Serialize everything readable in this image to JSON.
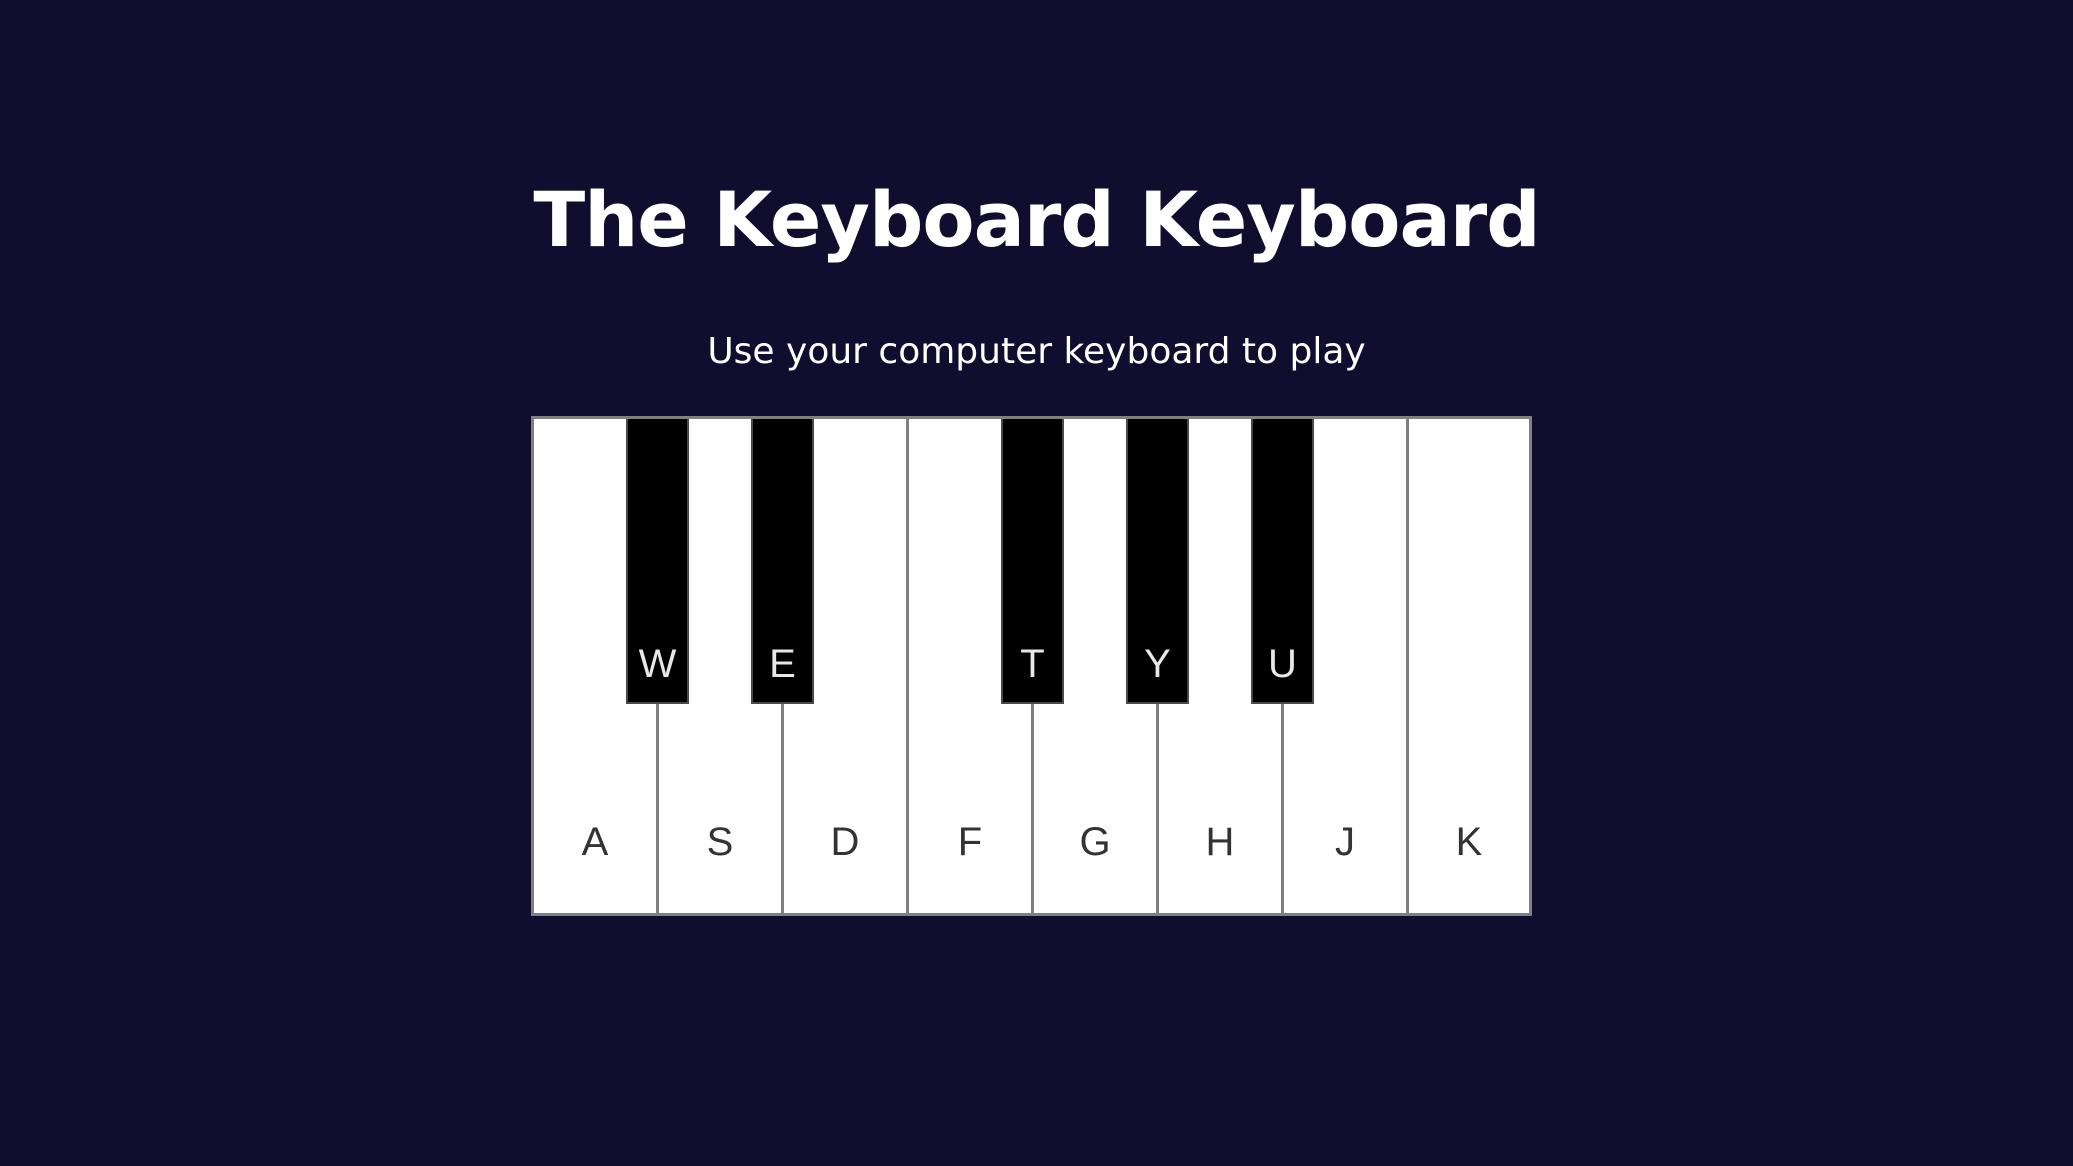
{
  "header": {
    "title": "The Keyboard Keyboard",
    "subtitle": "Use your computer keyboard to play"
  },
  "piano": {
    "white_keys": [
      {
        "label": "A"
      },
      {
        "label": "S"
      },
      {
        "label": "D"
      },
      {
        "label": "F"
      },
      {
        "label": "G"
      },
      {
        "label": "H"
      },
      {
        "label": "J"
      },
      {
        "label": "K"
      }
    ],
    "black_keys": [
      {
        "label": "W"
      },
      {
        "label": "E"
      },
      {
        "label": "T"
      },
      {
        "label": "Y"
      },
      {
        "label": "U"
      }
    ]
  },
  "colors": {
    "background": "#110d2e",
    "white_key": "#ffffff",
    "black_key": "#000000",
    "key_border": "#808080",
    "text": "#ffffff"
  }
}
